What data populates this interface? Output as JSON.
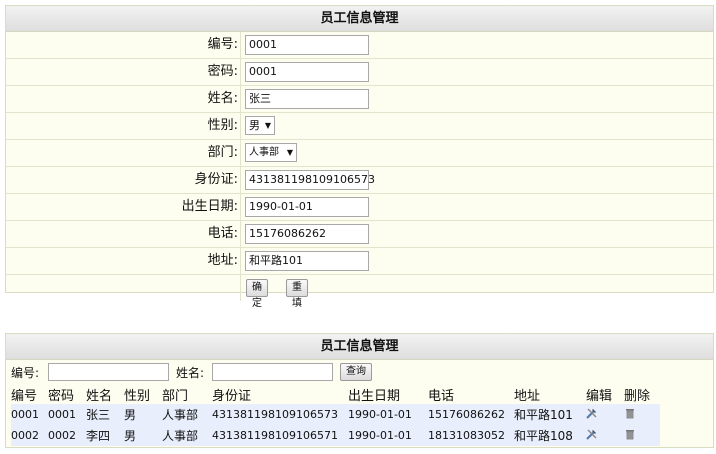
{
  "form": {
    "title": "员工信息管理",
    "labels": {
      "id": "编号:",
      "password": "密码:",
      "name": "姓名:",
      "gender": "性别:",
      "department": "部门:",
      "id_card": "身份证:",
      "birth_date": "出生日期:",
      "phone": "电话:",
      "address": "地址:"
    },
    "values": {
      "id": "0001",
      "password": "0001",
      "name": "张三",
      "gender": "男",
      "department": "人事部",
      "id_card": "431381198109106573",
      "birth_date": "1990-01-01",
      "phone": "15176086262",
      "address": "和平路101"
    },
    "confirm_label": "确定",
    "reset_label": "重填"
  },
  "list": {
    "title": "员工信息管理",
    "search": {
      "id_label": "编号:",
      "name_label": "姓名:",
      "query_label": "查询"
    },
    "columns": [
      "编号",
      "密码",
      "姓名",
      "性别",
      "部门",
      "身份证",
      "出生日期",
      "电话",
      "地址",
      "编辑",
      "删除"
    ],
    "rows": [
      [
        "0001",
        "0001",
        "张三",
        "男",
        "人事部",
        "431381198109106573",
        "1990-01-01",
        "15176086262",
        "和平路101"
      ],
      [
        "0002",
        "0002",
        "李四",
        "男",
        "人事部",
        "431381198109106571",
        "1990-01-01",
        "18131083052",
        "和平路108"
      ]
    ],
    "edit_icon": "edit-tools-icon",
    "delete_icon": "trash-icon"
  },
  "colors": {
    "panel_bg": "#fdfdf0",
    "row_bg": "#e8eefc",
    "header_bg": "#dedede"
  }
}
